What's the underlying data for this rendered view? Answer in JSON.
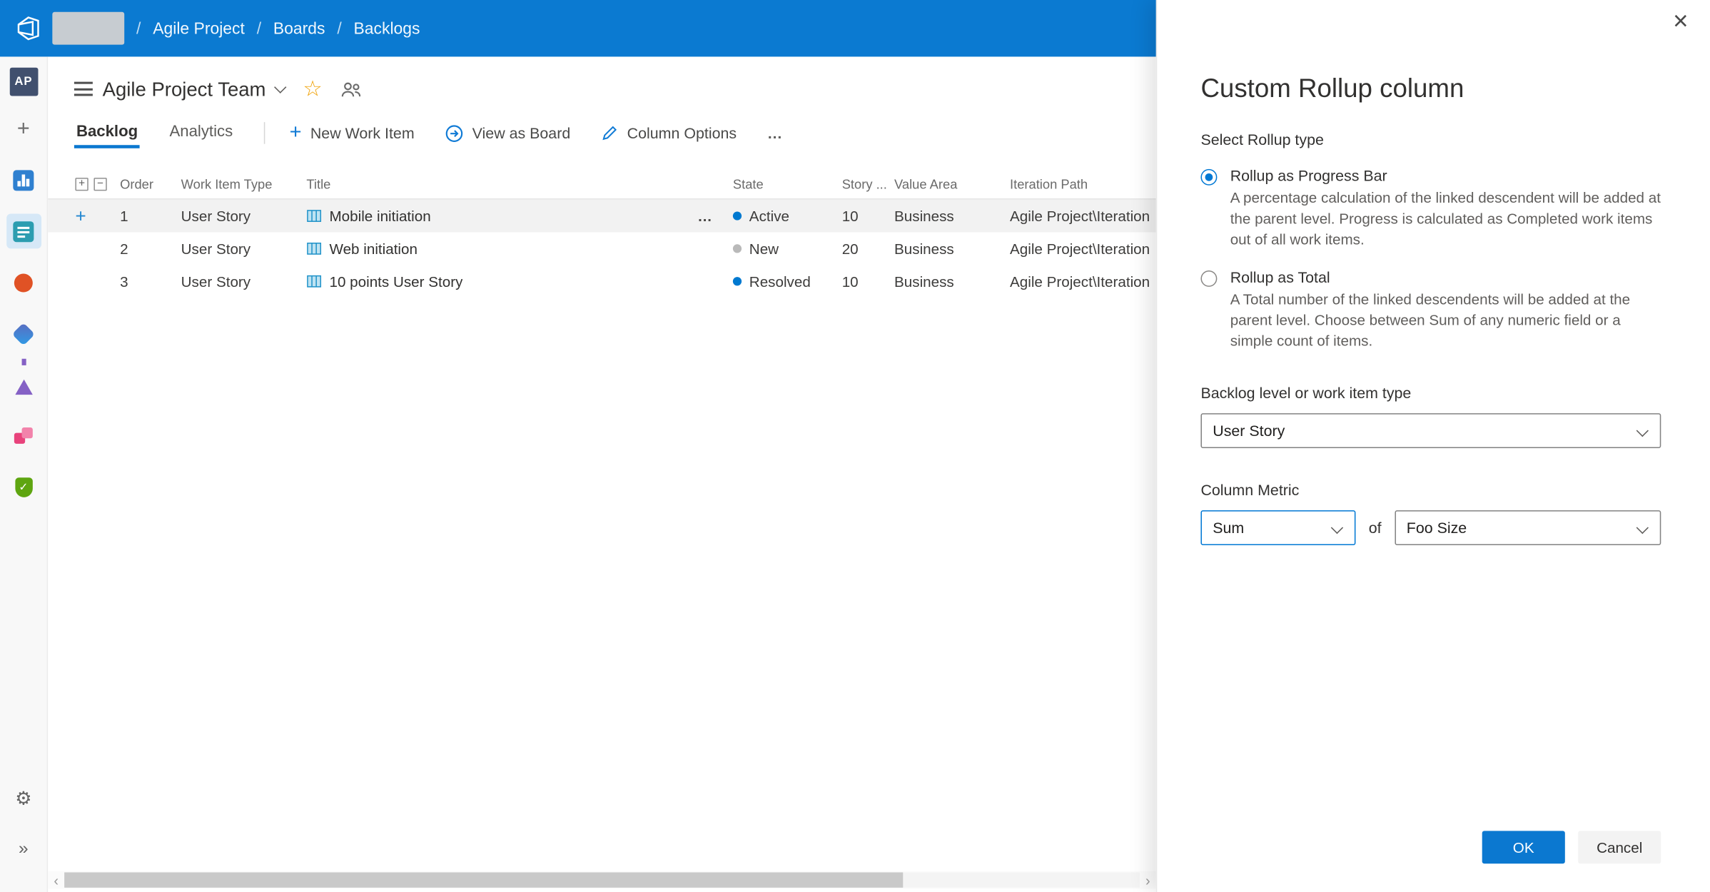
{
  "colors": {
    "accent": "#0078d4",
    "header": "#0b7ad1"
  },
  "header": {
    "breadcrumb_separator": "/",
    "breadcrumb": [
      "Agile Project",
      "Boards",
      "Backlogs"
    ]
  },
  "sidebar": {
    "avatar_initials": "AP",
    "items": [
      {
        "icon": "plus-icon"
      },
      {
        "icon": "dashboards-icon"
      },
      {
        "icon": "boards-icon",
        "active": true
      },
      {
        "icon": "repos-icon"
      },
      {
        "icon": "pipelines-icon"
      },
      {
        "icon": "test-plans-icon"
      },
      {
        "icon": "artifacts-icon"
      },
      {
        "icon": "compliance-icon"
      }
    ],
    "bottom": [
      {
        "icon": "gear-icon"
      },
      {
        "icon": "expand-icon"
      }
    ]
  },
  "team": {
    "title": "Agile Project Team"
  },
  "tabs": [
    {
      "label": "Backlog",
      "active": true
    },
    {
      "label": "Analytics",
      "active": false
    }
  ],
  "toolbar": {
    "new_work_item": "New Work Item",
    "view_as_board": "View as Board",
    "column_options": "Column Options",
    "more": "…"
  },
  "table": {
    "columns": {
      "order": "Order",
      "type": "Work Item Type",
      "title": "Title",
      "state": "State",
      "story": "Story ...",
      "value_area": "Value Area",
      "iteration": "Iteration Path"
    },
    "rows": [
      {
        "order": "1",
        "type": "User Story",
        "title": "Mobile initiation",
        "state": "Active",
        "state_color": "#0079d0",
        "story": "10",
        "value_area": "Business",
        "iteration": "Agile Project\\Iteration",
        "more": "…"
      },
      {
        "order": "2",
        "type": "User Story",
        "title": "Web initiation",
        "state": "New",
        "state_color": "#b9b9b9",
        "story": "20",
        "value_area": "Business",
        "iteration": "Agile Project\\Iteration"
      },
      {
        "order": "3",
        "type": "User Story",
        "title": "10 points User Story",
        "state": "Resolved",
        "state_color": "#0079d0",
        "story": "10",
        "value_area": "Business",
        "iteration": "Agile Project\\Iteration"
      }
    ]
  },
  "panel": {
    "title": "Custom Rollup column",
    "close_glyph": "×",
    "rollup_type_label": "Select Rollup type",
    "options": [
      {
        "label": "Rollup as Progress Bar",
        "description": "A percentage calculation of the linked descendent will be added at the parent level. Progress is calculated as Completed work items out of all work items.",
        "selected": true
      },
      {
        "label": "Rollup as Total",
        "description": "A Total number of the linked descendents will be added at the parent level. Choose between Sum of any numeric field or a simple count of items.",
        "selected": false
      }
    ],
    "backlog_level_label": "Backlog level or work item type",
    "backlog_level_value": "User Story",
    "column_metric_label": "Column Metric",
    "metric_value": "Sum",
    "of_label": "of",
    "field_value": "Foo Size",
    "ok_label": "OK",
    "cancel_label": "Cancel"
  }
}
